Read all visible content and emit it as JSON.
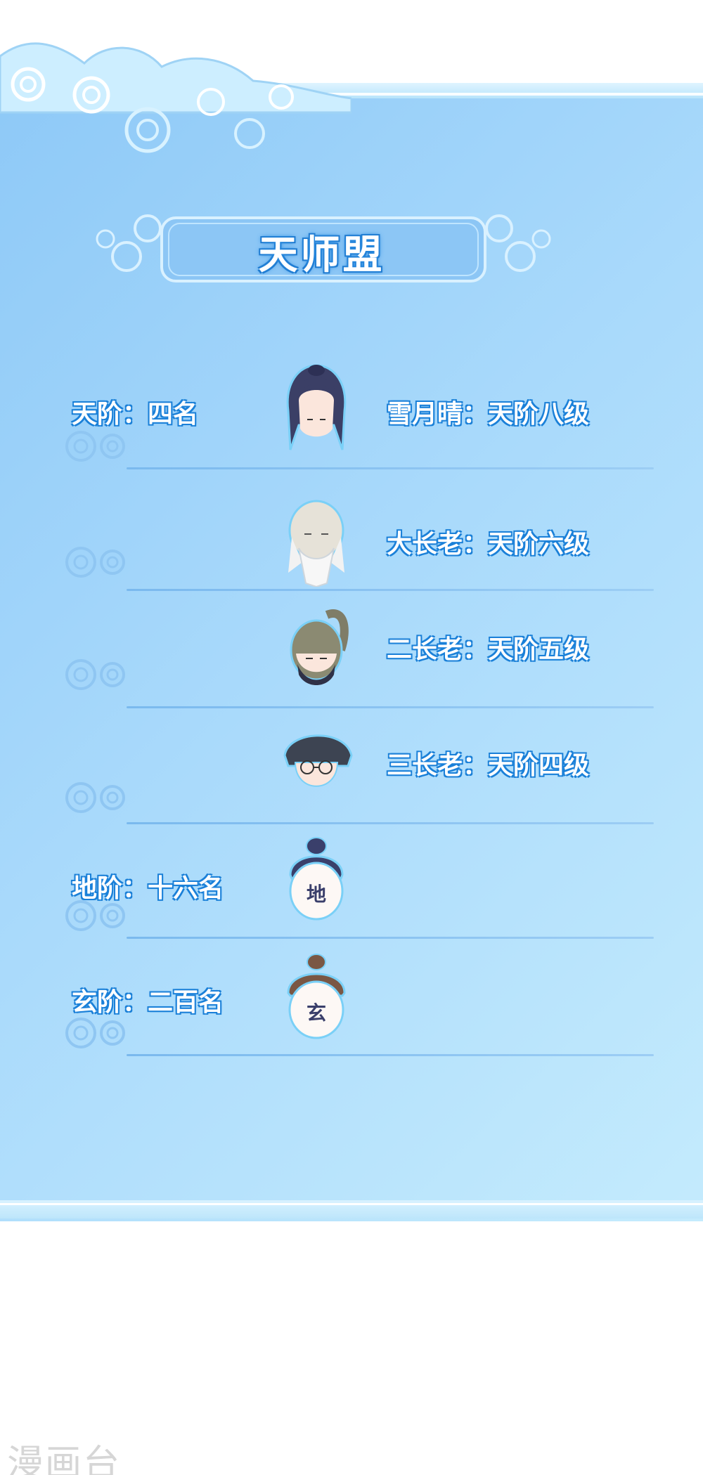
{
  "title": "天师盟",
  "rows": [
    {
      "rank": "天阶：四名",
      "member": "雪月晴：天阶八级",
      "avatar_icon": "long-haired-woman-avatar"
    },
    {
      "rank": "",
      "member": "大长老：天阶六级",
      "avatar_icon": "old-bearded-elder-avatar"
    },
    {
      "rank": "",
      "member": "二长老：天阶五级",
      "avatar_icon": "masked-ponytail-avatar"
    },
    {
      "rank": "",
      "member": "三长老：天阶四级",
      "avatar_icon": "glasses-man-avatar"
    },
    {
      "rank": "地阶：十六名",
      "member": "",
      "avatar_icon": "di-face-avatar",
      "face_char": "地"
    },
    {
      "rank": "玄阶：二百名",
      "member": "",
      "avatar_icon": "xuan-face-avatar",
      "face_char": "玄"
    }
  ],
  "watermark": "漫画台",
  "colors": {
    "panel": "#a8d9fb",
    "text_outline": "#1a7fd6",
    "line": "#7ab9ee"
  }
}
